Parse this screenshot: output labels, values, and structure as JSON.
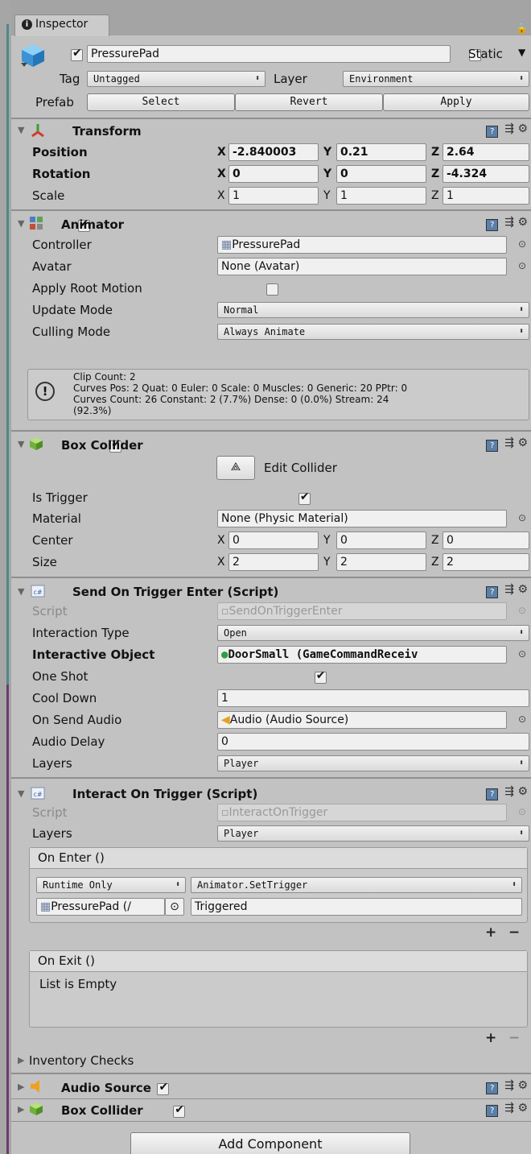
{
  "tab": {
    "title": "Inspector"
  },
  "object": {
    "name": "PressurePad",
    "active": true,
    "static_label": "Static",
    "tag_label": "Tag",
    "tag_value": "Untagged",
    "layer_label": "Layer",
    "layer_value": "Environment"
  },
  "prefab": {
    "label": "Prefab",
    "select": "Select",
    "revert": "Revert",
    "apply": "Apply"
  },
  "transform": {
    "title": "Transform",
    "position": {
      "label": "Position",
      "x": "-2.840003",
      "y": "0.21",
      "z": "2.64"
    },
    "rotation": {
      "label": "Rotation",
      "x": "0",
      "y": "0",
      "z": "-4.324"
    },
    "scale": {
      "label": "Scale",
      "x": "1",
      "y": "1",
      "z": "1"
    }
  },
  "animator": {
    "title": "Animator",
    "controller_label": "Controller",
    "controller_value": "PressurePad",
    "avatar_label": "Avatar",
    "avatar_value": "None (Avatar)",
    "root_motion_label": "Apply Root Motion",
    "update_label": "Update Mode",
    "update_value": "Normal",
    "culling_label": "Culling Mode",
    "culling_value": "Always Animate",
    "info": "Clip Count: 2\nCurves Pos: 2 Quat: 0 Euler: 0 Scale: 0 Muscles: 0 Generic: 20 PPtr: 0\nCurves Count: 26 Constant: 2 (7.7%) Dense: 0 (0.0%) Stream: 24\n(92.3%)"
  },
  "box_collider": {
    "title": "Box Collider",
    "edit_label": "Edit Collider",
    "trigger_label": "Is Trigger",
    "material_label": "Material",
    "material_value": "None (Physic Material)",
    "center_label": "Center",
    "center": {
      "x": "0",
      "y": "0",
      "z": "0"
    },
    "size_label": "Size",
    "size": {
      "x": "2",
      "y": "2",
      "z": "2"
    }
  },
  "send_script": {
    "title": "Send On Trigger Enter (Script)",
    "script_label": "Script",
    "script_value": "SendOnTriggerEnter",
    "interaction_label": "Interaction Type",
    "interaction_value": "Open",
    "object_label": "Interactive Object",
    "object_value": "DoorSmall (GameCommandReceiv",
    "oneshot_label": "One Shot",
    "cooldown_label": "Cool Down",
    "cooldown_value": "1",
    "audio_label": "On Send Audio",
    "audio_value": "Audio (Audio Source)",
    "delay_label": "Audio Delay",
    "delay_value": "0",
    "layers_label": "Layers",
    "layers_value": "Player"
  },
  "interact_script": {
    "title": "Interact On Trigger (Script)",
    "script_label": "Script",
    "script_value": "InteractOnTrigger",
    "layers_label": "Layers",
    "layers_value": "Player",
    "on_enter": "On Enter ()",
    "runtime": "Runtime Only",
    "function": "Animator.SetTrigger",
    "target": "PressurePad (/",
    "param": "Triggered",
    "on_exit": "On Exit ()",
    "empty": "List is Empty",
    "plus": "+",
    "minus": "−"
  },
  "inventory": {
    "label": "Inventory Checks"
  },
  "audio_source": {
    "title": "Audio Source"
  },
  "box_collider2": {
    "title": "Box Collider"
  },
  "add_component": "Add Component",
  "colors": {
    "panel": "#c2c2c2",
    "separator": "#8f8f8f",
    "object_dot": "#2ea043"
  }
}
